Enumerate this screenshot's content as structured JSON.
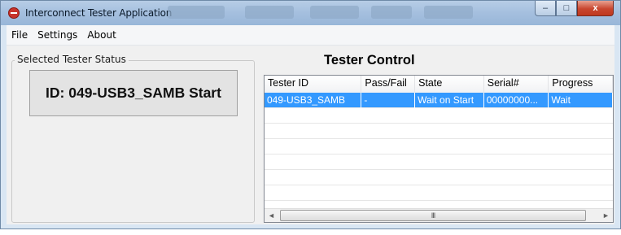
{
  "window": {
    "title": "Interconnect Tester Application",
    "controls": {
      "minimize": "–",
      "maximize": "□",
      "close": "x"
    }
  },
  "menu": [
    "File",
    "Settings",
    "About"
  ],
  "status_group": {
    "label": "Selected Tester Status",
    "text": "ID: 049-USB3_SAMB Start"
  },
  "tester_control": {
    "title": "Tester Control",
    "columns": [
      "Tester ID",
      "Pass/Fail",
      "State",
      "Serial#",
      "Progress"
    ],
    "rows": [
      {
        "tester_id": "049-USB3_SAMB",
        "pass_fail": "-",
        "state": "Wait on Start",
        "serial": "00000000...",
        "progress": "Wait",
        "selected": true
      }
    ],
    "scroll_left": "◄",
    "scroll_thumb": "III",
    "scroll_right": "►"
  },
  "colors": {
    "selection": "#3399ff",
    "close_button": "#c8462f"
  }
}
